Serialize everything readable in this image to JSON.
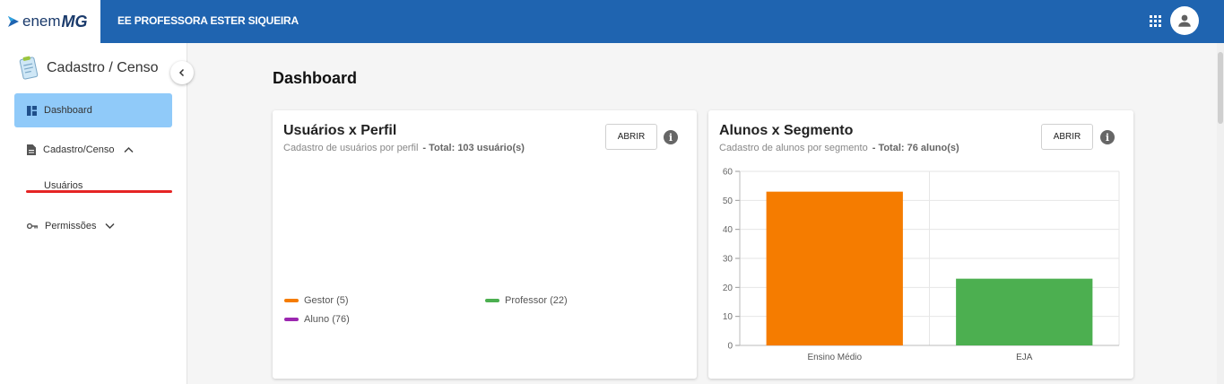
{
  "header": {
    "logo_text": "enem",
    "logo_bold": "MG",
    "school_name": "EE PROFESSORA ESTER SIQUEIRA",
    "bg_color": "#1f64b0"
  },
  "sidebar": {
    "title": "Cadastro / Censo",
    "items": [
      {
        "label": "Dashboard",
        "icon": "dashboard-icon",
        "active": true
      },
      {
        "label": "Cadastro/Censo",
        "icon": "document-icon",
        "expanded": true,
        "children": [
          {
            "label": "Usuários"
          }
        ]
      },
      {
        "label": "Permissões",
        "icon": "key-icon",
        "expanded": false
      }
    ],
    "active_color": "#90caf9"
  },
  "main": {
    "page_title": "Dashboard",
    "cards": [
      {
        "title": "Usuários x Perfil",
        "subtitle": "Cadastro de usuários por perfil",
        "total": "- Total: 103 usuário(s)",
        "button": "ABRIR",
        "legend": [
          {
            "label": "Gestor (5)",
            "color": "#f57c00"
          },
          {
            "label": "Professor (22)",
            "color": "#4caf50"
          },
          {
            "label": "Aluno (76)",
            "color": "#9c27b0"
          }
        ]
      },
      {
        "title": "Alunos x Segmento",
        "subtitle": "Cadastro de alunos por segmento",
        "total": "- Total: 76 aluno(s)",
        "button": "ABRIR"
      }
    ]
  },
  "chart_data": {
    "type": "bar",
    "categories": [
      "Ensino Médio",
      "EJA"
    ],
    "values": [
      53,
      23
    ],
    "colors": [
      "#f57c00",
      "#4caf50"
    ],
    "ylim": [
      0,
      60
    ],
    "yticks": [
      0,
      10,
      20,
      30,
      40,
      50,
      60
    ],
    "grid": true
  }
}
